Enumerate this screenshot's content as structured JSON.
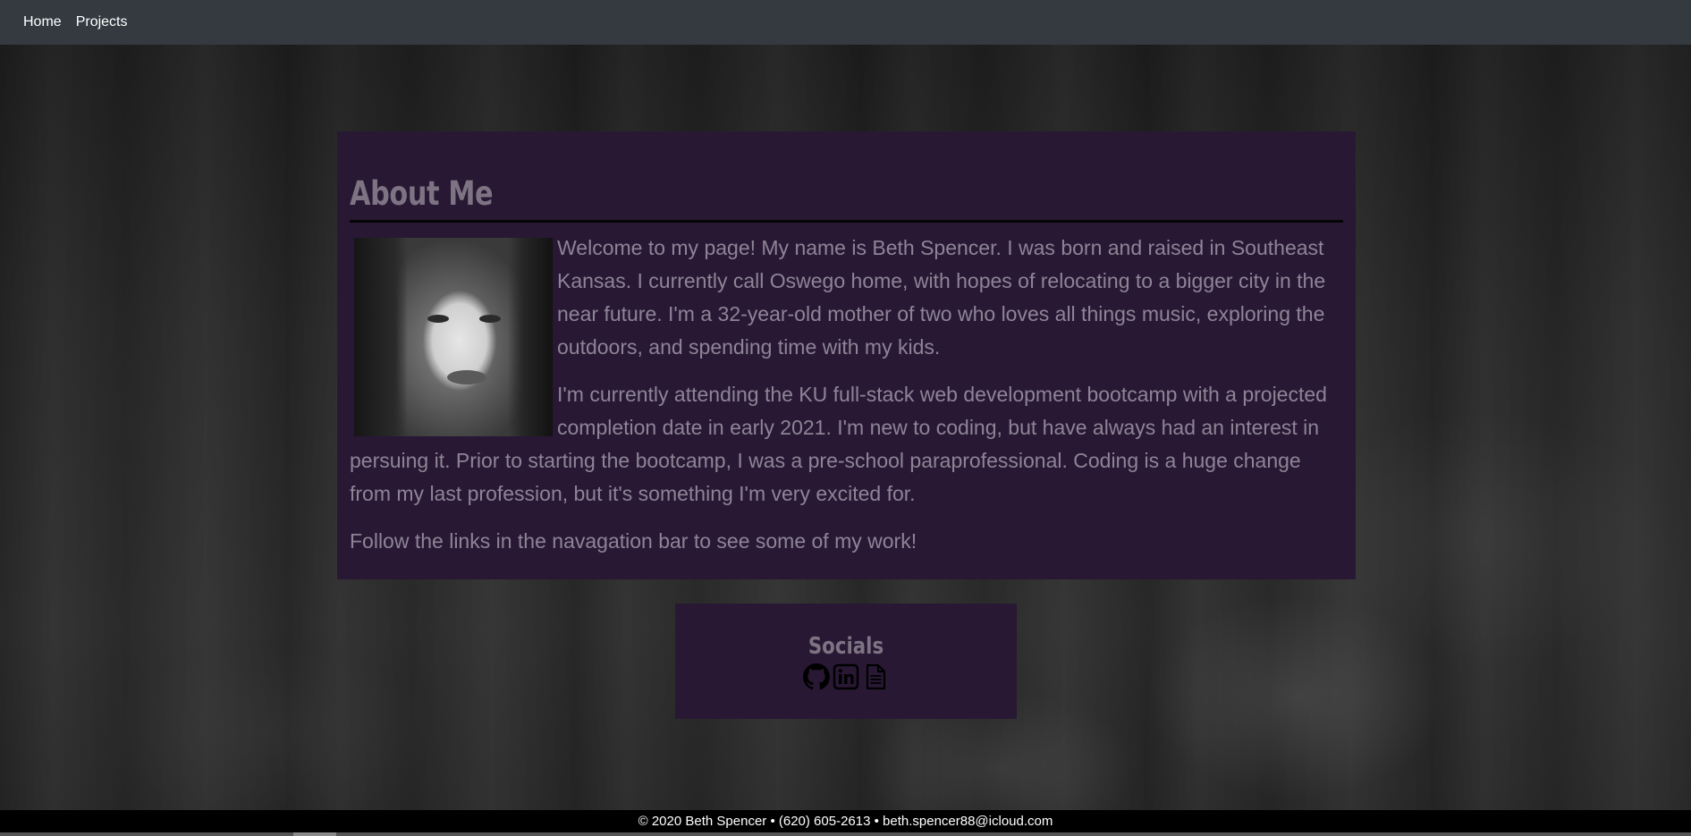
{
  "nav": {
    "links": [
      {
        "label": "Home"
      },
      {
        "label": "Projects"
      }
    ]
  },
  "about": {
    "title": "About Me",
    "image_alt": "portrait",
    "paragraphs": [
      "Welcome to my page! My name is Beth Spencer. I was born and raised in Southeast Kansas. I currently call Oswego home, with hopes of relocating to a bigger city in the near future. I'm a 32-year-old mother of two who loves all things music, exploring the outdoors, and spending time with my kids.",
      "I'm currently attending the KU full-stack web development bootcamp with a projected completion date in early 2021. I'm new to coding, but have always had an interest in persuing it. Prior to starting the bootcamp, I was a pre-school paraprofessional. Coding is a huge change from my last profession, but it's something I'm very excited for.",
      "Follow the links in the navagation bar to see some of my work!"
    ]
  },
  "socials": {
    "title": "Socials",
    "icons": [
      "github-icon",
      "linkedin-icon",
      "resume-icon"
    ]
  },
  "footer": {
    "text": "© 2020 Beth Spencer • (620) 605-2613 • beth.spencer88@icloud.com"
  },
  "colors": {
    "navbar": "#343a40",
    "card": "#281834",
    "heading": "#7d7383",
    "body_text": "#8e8496",
    "footer": "#000000"
  }
}
